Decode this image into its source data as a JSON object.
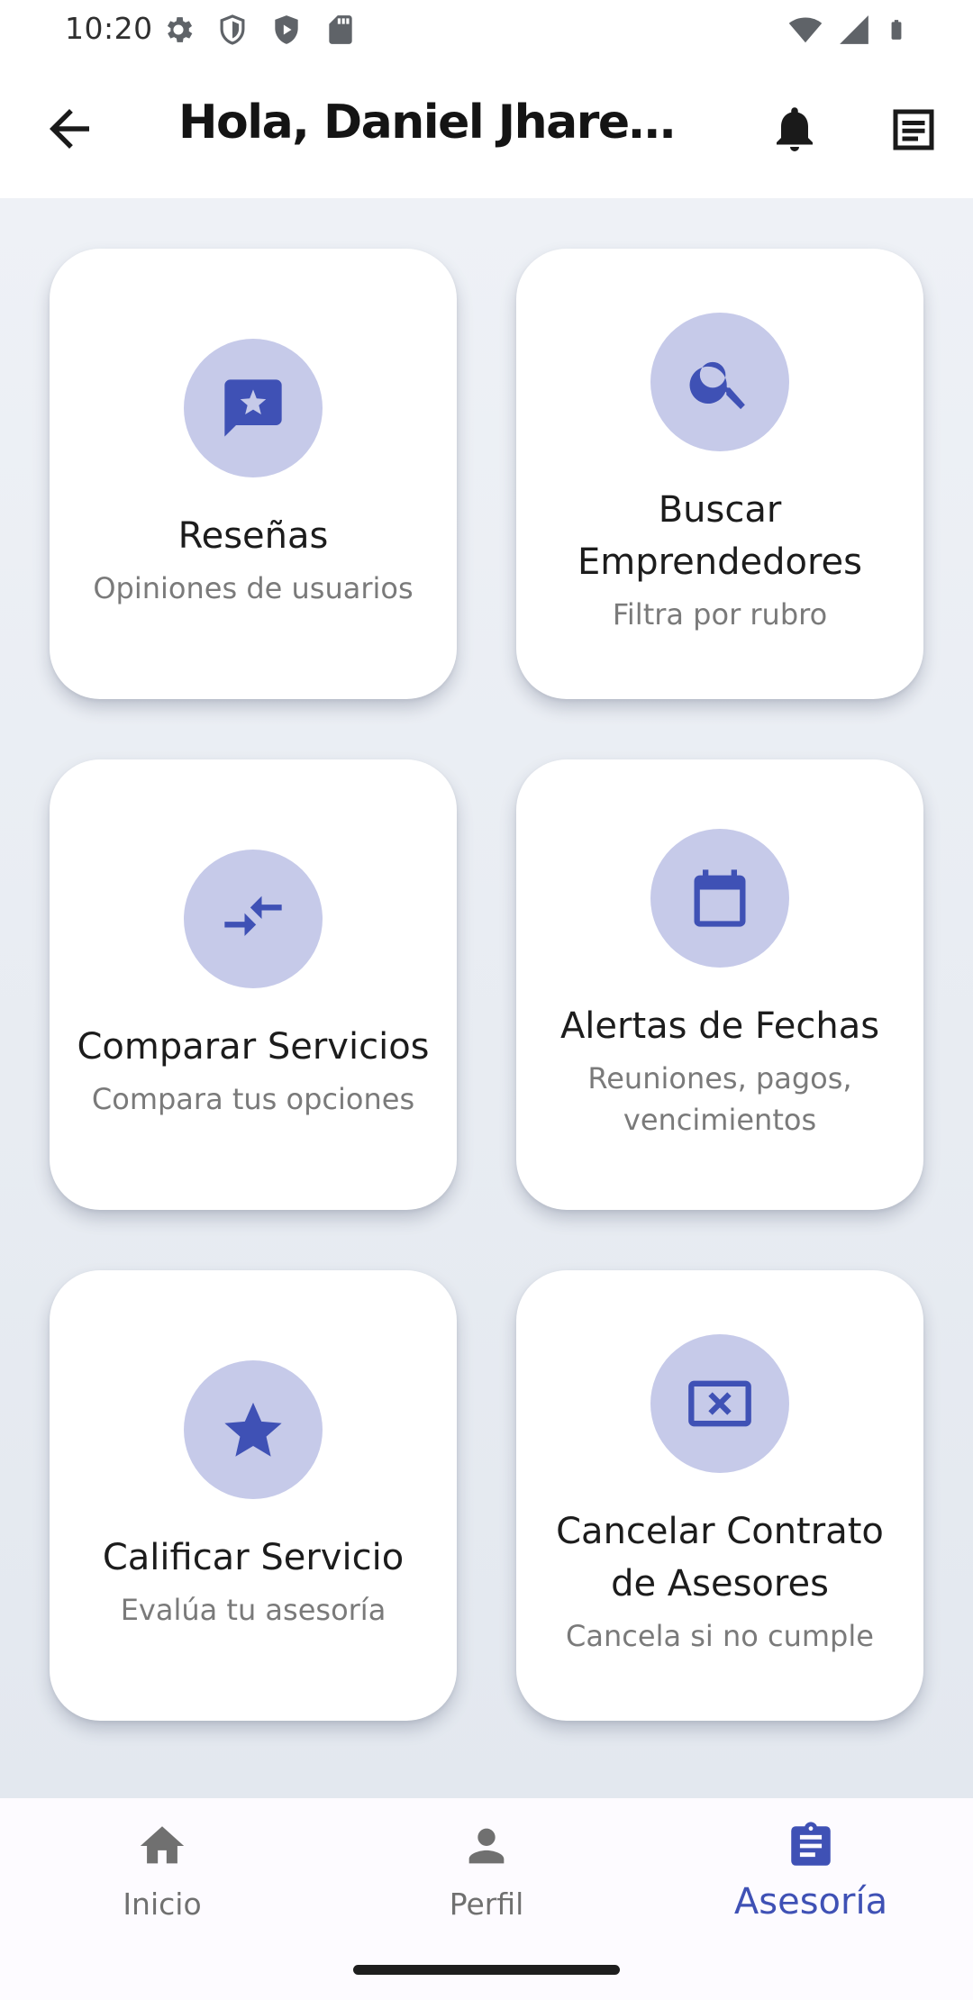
{
  "status_bar": {
    "time": "10:20",
    "left_icons": [
      "settings-icon",
      "shield-icon",
      "play-protect-icon",
      "sd-card-icon"
    ],
    "right_icons": [
      "wifi-icon",
      "cell-signal-icon",
      "battery-icon"
    ]
  },
  "app_bar": {
    "title": "Hola, Daniel Jhared Meza Mamani",
    "back_icon": "arrow-back-icon",
    "actions": [
      "bell-icon",
      "notes-icon"
    ]
  },
  "cards": [
    {
      "title": "Reseñas",
      "subtitle": "Opiniones de usuarios",
      "icon": "rate-review-icon"
    },
    {
      "title": "Buscar Emprendedores",
      "subtitle": "Filtra por rubro",
      "icon": "search-icon"
    },
    {
      "title": "Comparar Servicios",
      "subtitle": "Compara tus opciones",
      "icon": "compare-arrows-icon"
    },
    {
      "title": "Alertas de Fechas",
      "subtitle": "Reuniones, pagos, vencimientos",
      "icon": "calendar-icon"
    },
    {
      "title": "Calificar Servicio",
      "subtitle": "Evalúa tu asesoría",
      "icon": "star-icon"
    },
    {
      "title": "Cancelar Contrato de Asesores",
      "subtitle": "Cancela si no cumple",
      "icon": "cancel-presentation-icon"
    }
  ],
  "bottom_nav": {
    "items": [
      {
        "label": "Inicio",
        "icon": "home-icon",
        "active": false
      },
      {
        "label": "Perfil",
        "icon": "person-icon",
        "active": false
      },
      {
        "label": "Asesoría",
        "icon": "assignment-icon",
        "active": true
      }
    ]
  },
  "colors": {
    "accent": "#3f51b5",
    "icon_circle": "#c6cae9",
    "background": "#e8ecf2",
    "card": "#ffffff"
  }
}
